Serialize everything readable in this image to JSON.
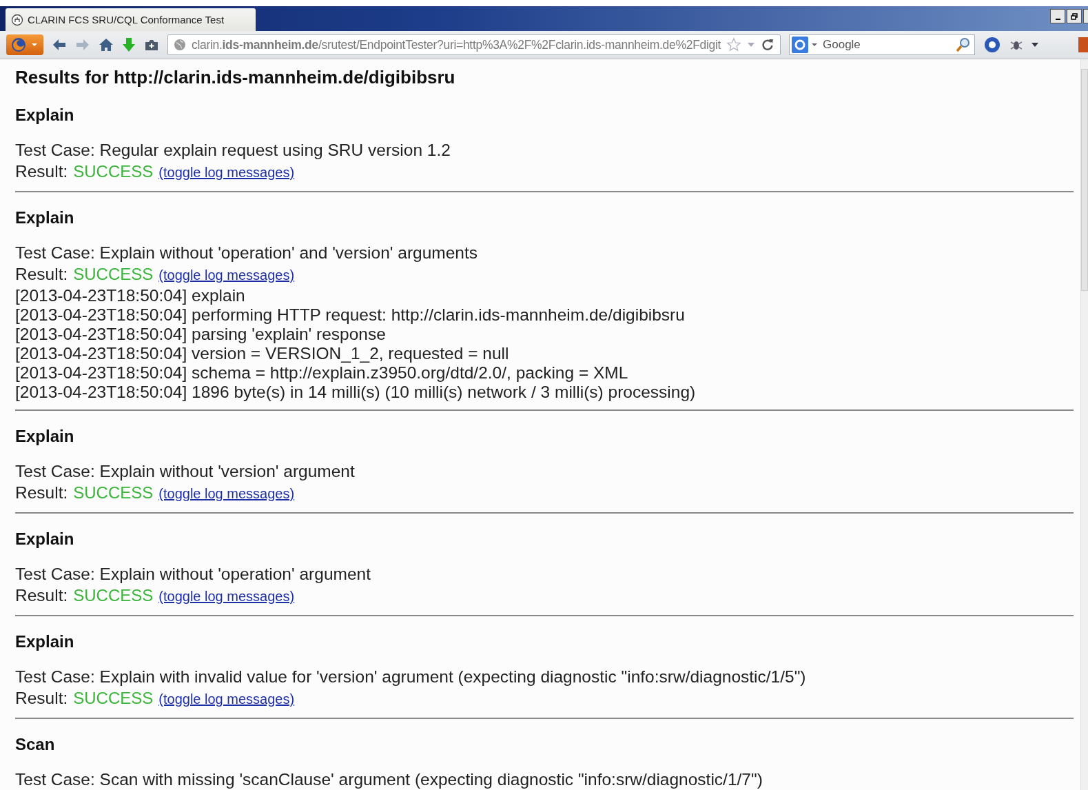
{
  "window": {
    "title": "CLARIN FCS SRU/CQL Conformance Test"
  },
  "toolbar": {
    "url": "clarin.**ids-mannheim.de**/srutest/EndpointTester?uri=http%3A%2F%2Fclarin.ids-mannheim.de%2Fdigit",
    "search": {
      "placeholder": "Google"
    }
  },
  "page": {
    "title": "Results for http://clarin.ids-mannheim.de/digibibsru",
    "sections": [
      {
        "heading": "Explain",
        "test_case": "Test Case: Regular explain request using SRU version 1.2",
        "result_label": "Result:",
        "result": "SUCCESS",
        "toggle": "(toggle log messages)"
      },
      {
        "heading": "Explain",
        "test_case": "Test Case: Explain without 'operation' and 'version' arguments",
        "result_label": "Result:",
        "result": "SUCCESS",
        "toggle": "(toggle log messages)",
        "log": [
          "[2013-04-23T18:50:04] explain",
          "[2013-04-23T18:50:04] performing HTTP request: http://clarin.ids-mannheim.de/digibibsru",
          "[2013-04-23T18:50:04] parsing 'explain' response",
          "[2013-04-23T18:50:04] version = VERSION_1_2, requested = null",
          "[2013-04-23T18:50:04] schema = http://explain.z3950.org/dtd/2.0/, packing = XML",
          "[2013-04-23T18:50:04] 1896 byte(s) in 14 milli(s) (10 milli(s) network / 3 milli(s) processing)"
        ]
      },
      {
        "heading": "Explain",
        "test_case": "Test Case: Explain without 'version' argument",
        "result_label": "Result:",
        "result": "SUCCESS",
        "toggle": "(toggle log messages)"
      },
      {
        "heading": "Explain",
        "test_case": "Test Case: Explain without 'operation' argument",
        "result_label": "Result:",
        "result": "SUCCESS",
        "toggle": "(toggle log messages)"
      },
      {
        "heading": "Explain",
        "test_case": "Test Case: Explain with invalid value for 'version' agrument (expecting diagnostic \"info:srw/diagnostic/1/5\")",
        "result_label": "Result:",
        "result": "SUCCESS",
        "toggle": "(toggle log messages)"
      },
      {
        "heading": "Scan",
        "test_case": "Test Case: Scan with missing 'scanClause' argument (expecting diagnostic \"info:srw/diagnostic/1/7\")"
      }
    ]
  }
}
